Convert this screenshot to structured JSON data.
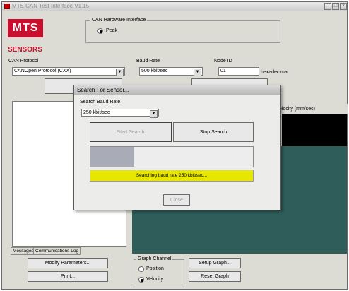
{
  "window": {
    "title": "MTS CAN Test Interface V1.15"
  },
  "logo": {
    "text": "MTS",
    "subtitle": "SENSORS"
  },
  "hardware": {
    "group_title": "CAN Hardware Interface",
    "option": "Peak"
  },
  "protocol": {
    "label": "CAN Protocol",
    "value": "CANOpen Protocol (CXX)"
  },
  "baud": {
    "label": "Baud Rate",
    "value": "500 kbit/sec"
  },
  "node": {
    "label": "Node ID",
    "value": "01",
    "unit": "hexadecimal"
  },
  "chart_panel": {
    "header": "elocity (mm/sec)"
  },
  "tabs": [
    {
      "label": "Messages"
    },
    {
      "label": "Communications Log"
    }
  ],
  "buttons": {
    "modify": "Modify Parameters...",
    "print": "Print...",
    "setup_graph": "Setup Graph...",
    "reset_graph": "Reset Graph"
  },
  "graph_channel": {
    "title": "Graph Channel",
    "position": "Position",
    "velocity": "Velocity"
  },
  "dialog": {
    "title": "Search For Sensor...",
    "search_baud_label": "Search Baud Rate",
    "search_baud_value": "250 kbit/sec",
    "start": "Start Search",
    "stop": "Stop Search",
    "status": "Searching baud rate 250 kbit/sec...",
    "close": "Close",
    "progress": 0.27
  },
  "colors": {
    "brand": "#c8102e",
    "status": "#e6e600",
    "graph_bg": "#2f5e5a"
  }
}
